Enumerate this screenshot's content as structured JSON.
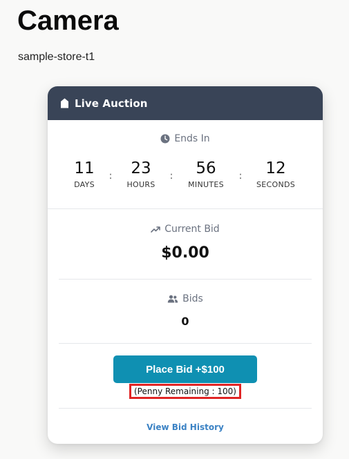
{
  "product": {
    "title": "Camera",
    "store": "sample-store-t1"
  },
  "auction": {
    "header_title": "Live Auction",
    "ends_label": "Ends In",
    "countdown": [
      {
        "value": "11",
        "label": "DAYS"
      },
      {
        "value": "23",
        "label": "HOURS"
      },
      {
        "value": "56",
        "label": "MINUTES"
      },
      {
        "value": "12",
        "label": "SECONDS"
      }
    ],
    "separator": ":",
    "current_bid_label": "Current Bid",
    "current_bid_value": "$0.00",
    "bids_label": "Bids",
    "bids_value": "0",
    "place_bid_label": "Place Bid +$100",
    "penny_remaining": "(Penny Remaining : 100)",
    "history_link": "View Bid History"
  },
  "colors": {
    "header_bg": "#394457",
    "button_bg": "#0f90b2",
    "highlight_border": "#e02424",
    "link": "#3b82c4"
  },
  "icons": {
    "header": "tag-icon",
    "ends": "clock-icon",
    "current_bid": "trending-up-icon",
    "bids": "users-icon"
  }
}
